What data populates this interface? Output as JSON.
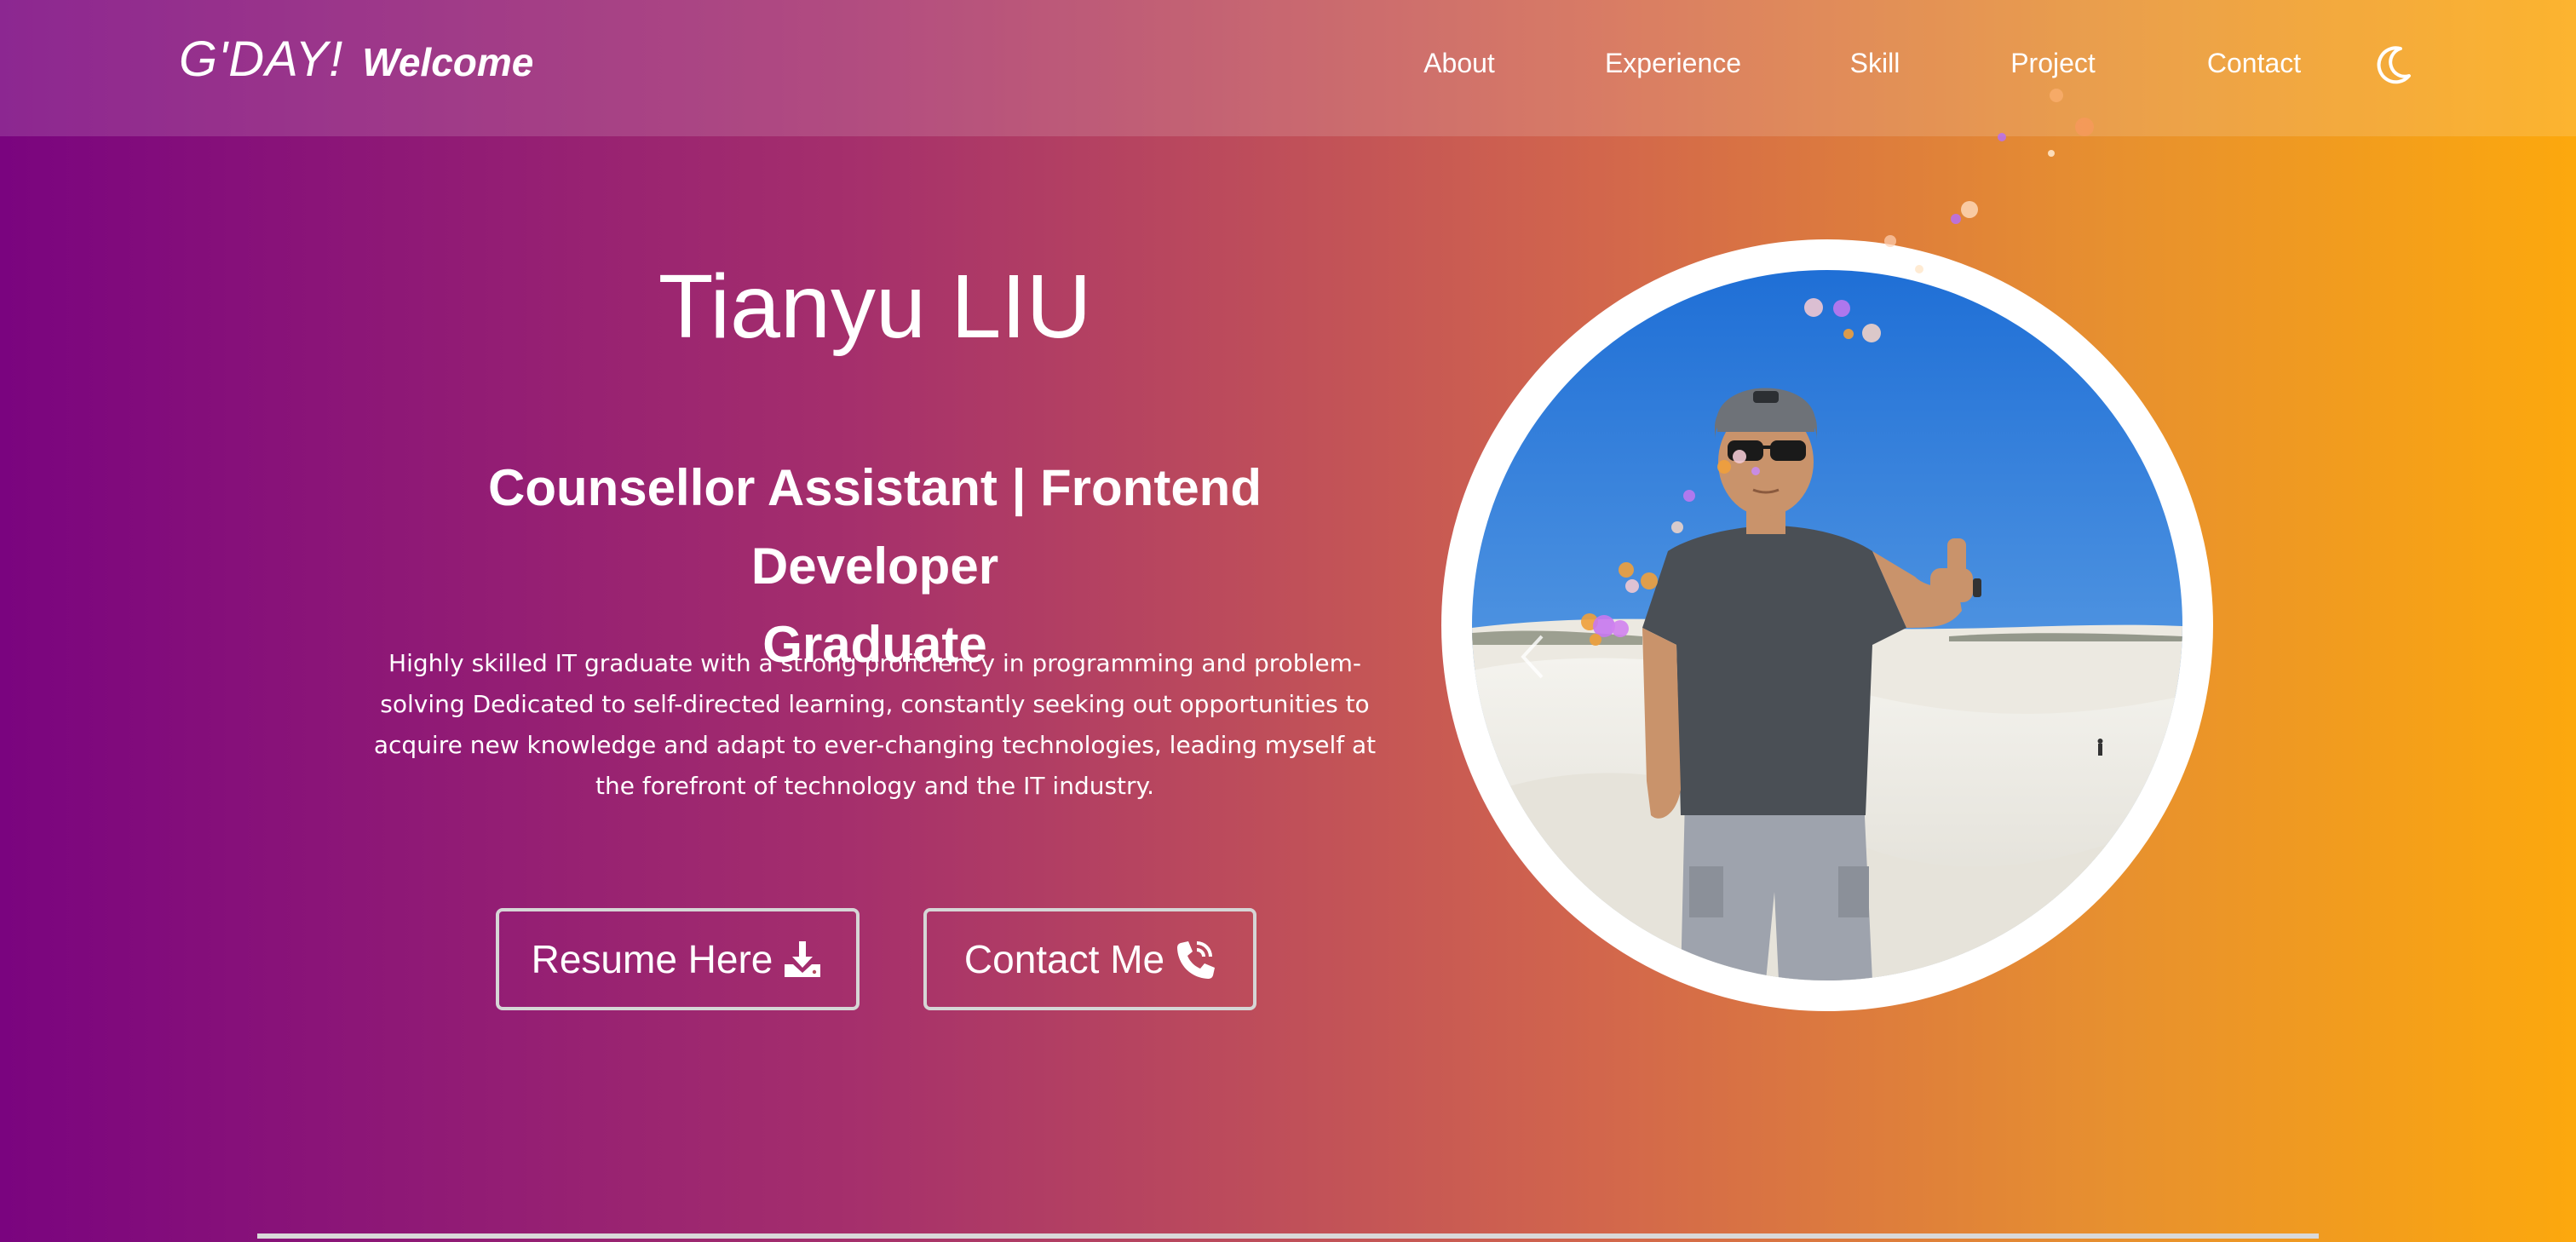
{
  "brand": {
    "greeting": "G'DAY!",
    "welcome": "Welcome"
  },
  "nav": {
    "items": [
      {
        "label": "About"
      },
      {
        "label": "Experience"
      },
      {
        "label": "Skill"
      },
      {
        "label": "Project"
      },
      {
        "label": "Contact"
      }
    ],
    "theme_toggle_icon": "moon-icon"
  },
  "hero": {
    "name": "Tianyu LIU",
    "role_line1": "Counsellor Assistant | Frontend Developer",
    "role_line2": "Graduate",
    "description": "Highly skilled IT graduate with a strong proficiency in programming and problem-solving Dedicated to self-directed learning, constantly seeking out opportunities to acquire new knowledge and adapt to ever-changing technologies, leading myself at the forefront of technology and the IT industry."
  },
  "buttons": {
    "resume_label": "Resume Here",
    "resume_icon": "download-icon",
    "contact_label": "Contact Me",
    "contact_icon": "phone-call-icon"
  },
  "carousel": {
    "prev_icon": "chevron-left-icon",
    "next_icon": "chevron-right-icon",
    "slide_count": 2,
    "active_slide": 2
  },
  "colors": {
    "gradient_start": "#7a047f",
    "gradient_end": "#fca80d",
    "text": "#ffffff",
    "button_border": "#d6d6d6"
  }
}
